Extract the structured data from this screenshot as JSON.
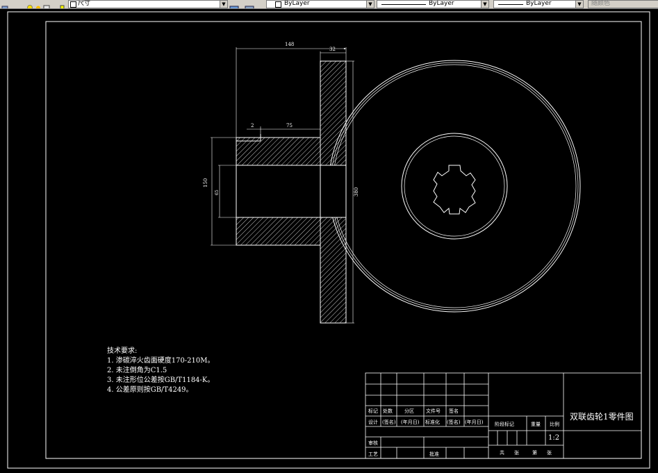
{
  "toolbar": {
    "dim_style": "尺寸",
    "color_layer": "ByLayer",
    "linetype": "ByLayer",
    "lineweight": "ByLayer",
    "plot_style": "随颜色"
  },
  "drawing": {
    "dims": {
      "overall_length": "148",
      "flange_width": "32",
      "small_left": "2",
      "hub_length": "75",
      "bore_dia": "150",
      "small_dia": "65",
      "flange_dia": "380"
    },
    "notes": {
      "heading": "技术要求:",
      "items": [
        "1. 渗碳淬火齿面硬度170-210M。",
        "2. 未注倒角为C1.5",
        "3. 未注形位公差按GB/T1184-K。",
        "4. 公差原则按GB/T4249。"
      ]
    },
    "title_block": {
      "part_name": "双联齿轮1零件图",
      "scale": "1:2",
      "labels": {
        "mark": "标记",
        "count": "处数",
        "zone": "分区",
        "doc_no": "文件号",
        "signature": "签名",
        "design": "设计",
        "signed_name": "(签名)",
        "date": "(年月日)",
        "standardize": "标准化",
        "signed_name2": "(签名)",
        "date2": "(年月日)",
        "stage_mark": "阶段标记",
        "weight": "重量",
        "ratio": "比例",
        "review": "审核",
        "process": "工艺",
        "approve": "批准",
        "total": "共",
        "sheets": "张",
        "page": "第",
        "sheet": "张"
      }
    }
  }
}
